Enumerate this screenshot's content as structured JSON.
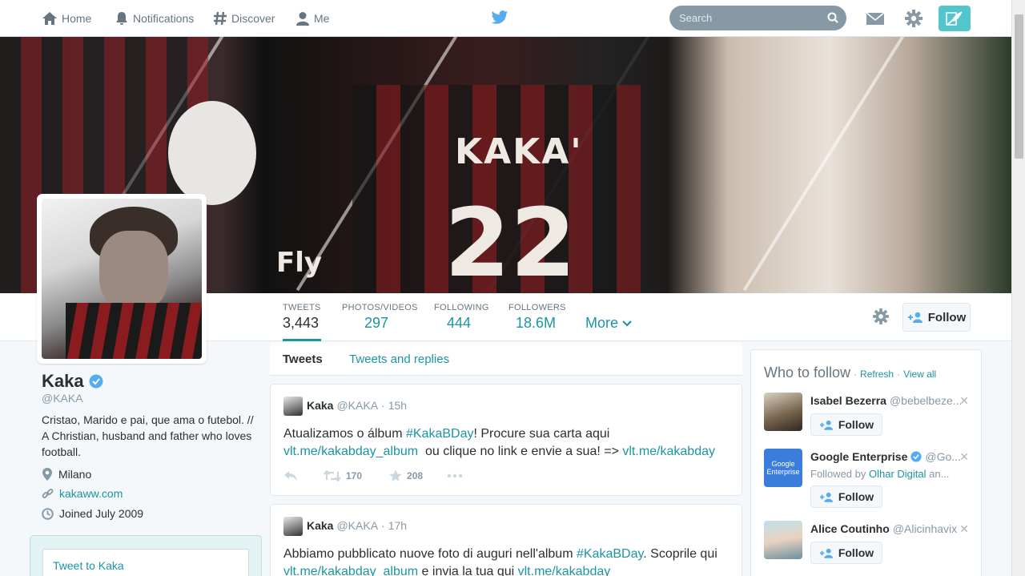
{
  "nav": {
    "home": "Home",
    "notifications": "Notifications",
    "discover": "Discover",
    "me": "Me",
    "search_placeholder": "Search"
  },
  "banner": {
    "jersey_name": "KAKA'",
    "jersey_number": "22",
    "sponsor_fragment": "Fly"
  },
  "profile_nav": {
    "stats": [
      {
        "label": "TWEETS",
        "value": "3,443"
      },
      {
        "label": "PHOTOS/VIDEOS",
        "value": "297"
      },
      {
        "label": "FOLLOWING",
        "value": "444"
      },
      {
        "label": "FOLLOWERS",
        "value": "18.6M"
      }
    ],
    "more": "More",
    "follow": "Follow"
  },
  "profile": {
    "name": "Kaka",
    "handle": "@KAKA",
    "bio": "Cristao, Marido e pai, que ama o futebol. // A Christian, husband and father who loves football.",
    "location": "Milano",
    "url": "kakaww.com",
    "joined": "Joined July 2009",
    "tweet_to": "Tweet to Kaka"
  },
  "timeline": {
    "tabs": [
      "Tweets",
      "Tweets and replies"
    ],
    "tweets": [
      {
        "name": "Kaka",
        "handle": "@KAKA",
        "sep": "·",
        "time": "15h",
        "text_a": "Atualizamos o álbum ",
        "hashtag": "#KakaBDay",
        "text_b": "! Procure sua carta aqui",
        "link1": "vlt.me/kakabday_album",
        "text_c": "  ou clique no link e envie a sua! => ",
        "link2": "vlt.me/kakabday",
        "retweets": "170",
        "favorites": "208"
      },
      {
        "name": "Kaka",
        "handle": "@KAKA",
        "sep": "·",
        "time": "17h",
        "text_a": "Abbiamo pubblicato nuove foto di auguri nell'album ",
        "hashtag": "#KakaBDay",
        "text_b": ". Scoprile qui",
        "link1": "vlt.me/kakabday_album",
        "text_c": " e invia la tua qui ",
        "link2": "vlt.me/kakabday"
      }
    ]
  },
  "who_to_follow": {
    "title": "Who to follow",
    "sep": "·",
    "refresh": "Refresh",
    "view_all": "View all",
    "close": "✕",
    "follow": "Follow",
    "suggestions": [
      {
        "name": "Isabel Bezerra",
        "handle": "@bebelbeze...",
        "sub_prefix": "",
        "sub_link": "",
        "sub_suffix": ""
      },
      {
        "name": "Google Enterprise",
        "handle": "@Go...",
        "sub_prefix": "Followed by ",
        "sub_link": "Olhar Digital",
        "sub_suffix": " an..."
      },
      {
        "name": "Alice Coutinho",
        "handle": "@Alicinhavix",
        "sub_prefix": "",
        "sub_link": "",
        "sub_suffix": ""
      }
    ],
    "google_logo_line1": "Google",
    "google_logo_line2": "Enterprise"
  },
  "colors": {
    "accent": "#1b95a2",
    "compose": "#55c5cc",
    "verified": "#55acee"
  }
}
